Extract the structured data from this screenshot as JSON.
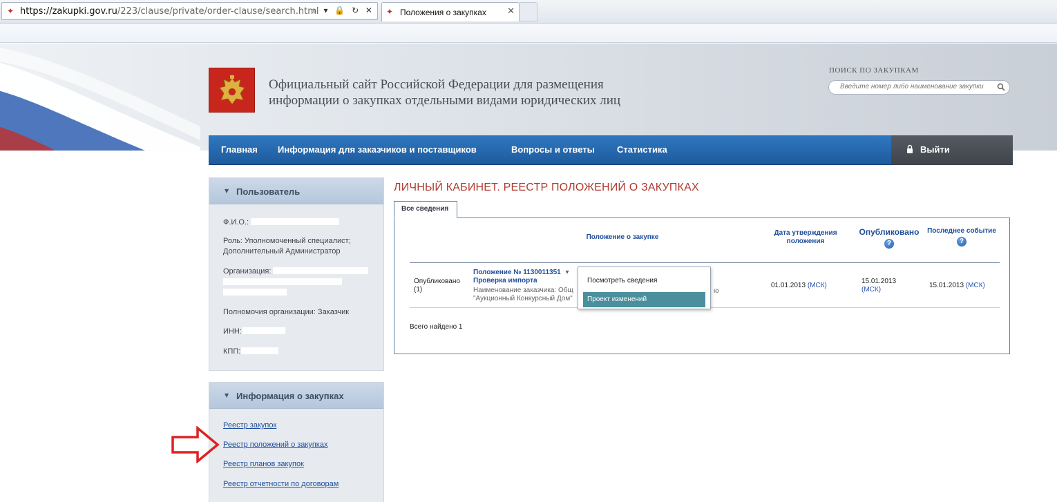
{
  "browser": {
    "url_host": "https://zakupki.gov.ru",
    "url_path": "/223/clause/private/order-clause/search.html",
    "tab_title": "Положения о закупках",
    "tab_close": "✕",
    "address_icons": "⌕ ▾ 🔒 ↻ ✕"
  },
  "header": {
    "title_line1": "Официальный сайт Российской Федерации для размещения",
    "title_line2": "информации о закупках отдельными видами юридических лиц",
    "search_label": "ПОИСК ПО ЗАКУПКАМ",
    "search_placeholder": "Введите номер либо наименование закупки"
  },
  "nav": {
    "items": [
      "Главная",
      "Информация для заказчиков и поставщиков",
      "Вопросы и ответы",
      "Статистика"
    ],
    "logout": "Выйти"
  },
  "user_panel": {
    "title": "Пользователь",
    "arrow": "▼",
    "fio_label": "Ф.И.О.:",
    "role_line1": "Роль: Уполномоченный специалист;",
    "role_line2": "Дополнительный Администратор",
    "org_label": "Организация:",
    "powers": "Полномочия организации: Заказчик",
    "inn_label": "ИНН:",
    "kpp_label": "КПП:"
  },
  "info_panel": {
    "title": "Информация о закупках",
    "arrow": "▼",
    "links": [
      "Реестр закупок",
      "Реестр положений о закупках",
      "Реестр планов закупок",
      "Реестр отчетности по договорам"
    ]
  },
  "main": {
    "heading": "ЛИЧНЫЙ КАБИНЕТ. РЕЕСТР ПОЛОЖЕНИЙ О ЗАКУПКАХ",
    "tab_all": "Все сведения",
    "columns": {
      "clause": "Положение о закупке",
      "approval_line1": "Дата утверждения",
      "approval_line2": "положения",
      "published": "Опубликовано",
      "last_event": "Последнее событие",
      "help": "?"
    },
    "row": {
      "status_line1": "Опубликовано",
      "status_line2": "(1)",
      "clause_number": "Положение № 1130011351",
      "clause_caret": "▾",
      "clause_subtitle": "Проверка импорта",
      "customer_line1": "Наименование заказчика: Общ",
      "customer_line1_tail": "ю",
      "customer_line2": "\"Аукционный Конкурсный Дом\"",
      "approval_date": "01.01.2013",
      "tz": "(МСК)",
      "published_date": "15.01.2013",
      "last_event_date": "15.01.2013"
    },
    "total": "Всего найдено 1",
    "dropdown": {
      "view": "Посмотреть сведения",
      "draft": "Проект изменений"
    }
  },
  "colors": {
    "nav_blue": "#2f78c0",
    "heading_red": "#b03a30",
    "link_blue": "#1f4e9a",
    "menu_highlight": "#4a8f9e",
    "annotation_red": "#e02020"
  }
}
